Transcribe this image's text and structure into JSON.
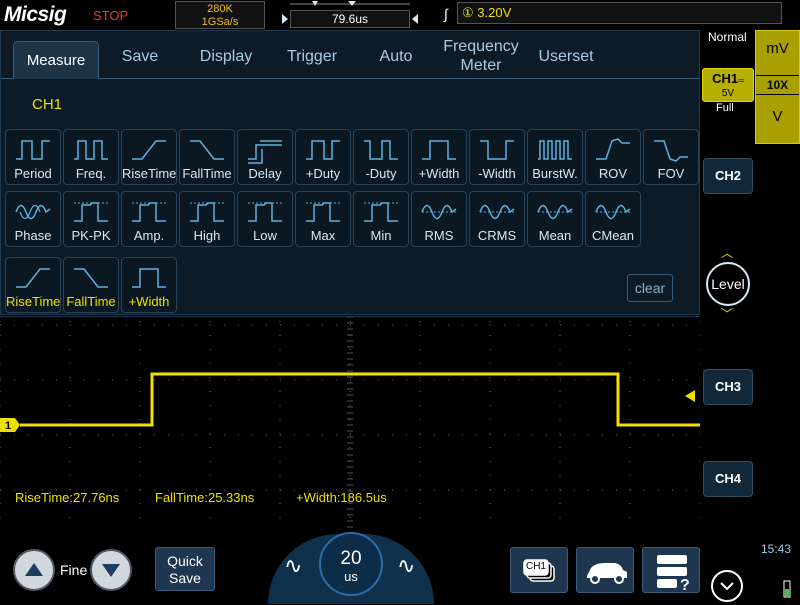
{
  "header": {
    "logo": "Micsig",
    "run_state": "STOP",
    "memory_depth": "280K",
    "sample_rate": "1GSa/s",
    "trigger_position": "79.6us",
    "trigger_source": "①",
    "trigger_level": "3.20V"
  },
  "tabs": [
    {
      "label": "Measure"
    },
    {
      "label": "Save"
    },
    {
      "label": "Display"
    },
    {
      "label": "Trigger"
    },
    {
      "label": "Auto"
    },
    {
      "label": "Frequency Meter"
    },
    {
      "label": "Userset"
    }
  ],
  "measure": {
    "channel_label": "CH1",
    "row1": [
      "Period",
      "Freq.",
      "RiseTime",
      "FallTime",
      "Delay",
      "+Duty",
      "-Duty",
      "+Width",
      "-Width",
      "BurstW.",
      "ROV",
      "FOV"
    ],
    "row2": [
      "Phase",
      "PK-PK",
      "Amp.",
      "High",
      "Low",
      "Max",
      "Min",
      "RMS",
      "CRMS",
      "Mean",
      "CMean"
    ],
    "selected": [
      "RiseTime",
      "FallTime",
      "+Width"
    ],
    "clear_label": "clear"
  },
  "readouts": [
    {
      "text": "RiseTime:27.76ns"
    },
    {
      "text": "FallTime:25.33ns"
    },
    {
      "text": "+Width:186.5us"
    }
  ],
  "channel_marker": "1",
  "right_panel": {
    "trigger_mode": "Normal",
    "ch1": {
      "label": "CH1",
      "scale": "5V",
      "coupling_mark": "═",
      "bandwidth": "Full"
    },
    "units": {
      "up": "mV",
      "probe": "10X",
      "down": "V"
    },
    "ch2": "CH2",
    "ch3": "CH3",
    "ch4": "CH4",
    "level_label": "Level"
  },
  "bottom": {
    "fine_label": "Fine",
    "quick_save": [
      "Quick",
      "Save"
    ],
    "timebase_value": "20",
    "timebase_unit": "us",
    "channel_icon_label": "CH1",
    "time": "15:43"
  },
  "colors": {
    "trace": "#f0e000",
    "panel_bg": "#0d1b27",
    "ch1": "#b5b000",
    "stop": "#e23b2e"
  }
}
